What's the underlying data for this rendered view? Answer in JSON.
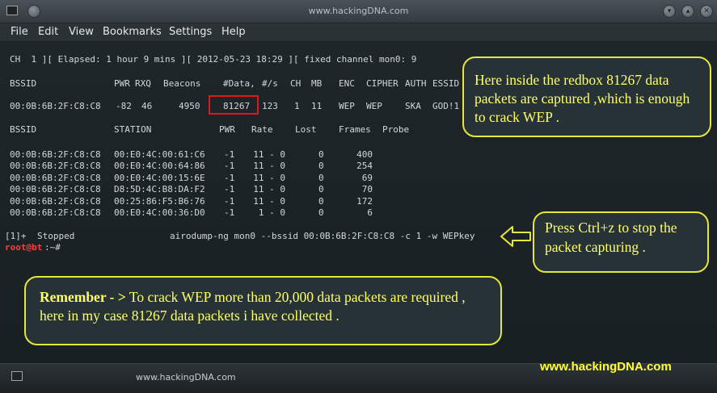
{
  "window": {
    "title": "www.hackingDNA.com"
  },
  "menu": [
    "File",
    "Edit",
    "View",
    "Bookmarks",
    "Settings",
    "Help"
  ],
  "terminal": {
    "status_line": "CH  1 ][ Elapsed: 1 hour 9 mins ][ 2012-05-23 18:29 ][ fixed channel mon0: 9",
    "ap_header": [
      "BSSID",
      "PWR",
      "RXQ",
      "Beacons",
      "#Data,",
      "#/s",
      "CH",
      "MB",
      "ENC",
      "CIPHER",
      "AUTH",
      "ESSID"
    ],
    "ap_row": [
      "00:0B:6B:2F:C8:C8",
      "-82",
      "46",
      "4950",
      "81267",
      "123",
      "1",
      "11",
      "WEP",
      "WEP",
      "SKA",
      "GOD!1"
    ],
    "station_header": [
      "BSSID",
      "STATION",
      "PWR",
      "Rate",
      "Lost",
      "Frames",
      "Probe"
    ],
    "stations": [
      [
        "00:0B:6B:2F:C8:C8",
        "00:E0:4C:00:61:C6",
        "-1",
        "11 - 0",
        "0",
        "400"
      ],
      [
        "00:0B:6B:2F:C8:C8",
        "00:E0:4C:00:64:86",
        "-1",
        "11 - 0",
        "0",
        "254"
      ],
      [
        "00:0B:6B:2F:C8:C8",
        "00:E0:4C:00:15:6E",
        "-1",
        "11 - 0",
        "0",
        "69"
      ],
      [
        "00:0B:6B:2F:C8:C8",
        "D8:5D:4C:B8:DA:F2",
        "-1",
        "11 - 0",
        "0",
        "70"
      ],
      [
        "00:0B:6B:2F:C8:C8",
        "00:25:86:F5:B6:76",
        "-1",
        "11 - 0",
        "0",
        "172"
      ],
      [
        "00:0B:6B:2F:C8:C8",
        "00:E0:4C:00:36:D0",
        "-1",
        "1 - 0",
        "0",
        "6"
      ]
    ],
    "job": {
      "id": "[1]+",
      "state": "Stopped",
      "command": "airodump-ng mon0 --bssid 00:0B:6B:2F:C8:C8 -c 1 -w WEPkey"
    },
    "prompt": {
      "user": "root@bt",
      "path": ":~#"
    }
  },
  "callouts": {
    "redbox_note": "Here inside the redbox 81267 data packets are captured ,which is enough to crack WEP .",
    "stop_note": "Press Ctrl+z to stop the packet capturing .",
    "remember_prefix": "Remember - >",
    "remember_text": " To crack WEP more than 20,000 data packets are required , here in my case 81267 data packets i have collected ."
  },
  "taskbar": {
    "label": "www.hackingDNA.com"
  },
  "watermark": "www.hackingDNA.com",
  "colors": {
    "terminal_bg": "#1d2327",
    "highlight_box": "#e0181b",
    "callout_border": "#e7e73b",
    "callout_text": "#ffff66",
    "prompt_user": "#ff3b3b"
  },
  "icons": [
    "terminal-icon",
    "minimize-icon",
    "maximize-icon",
    "close-icon",
    "left-arrow-icon"
  ]
}
